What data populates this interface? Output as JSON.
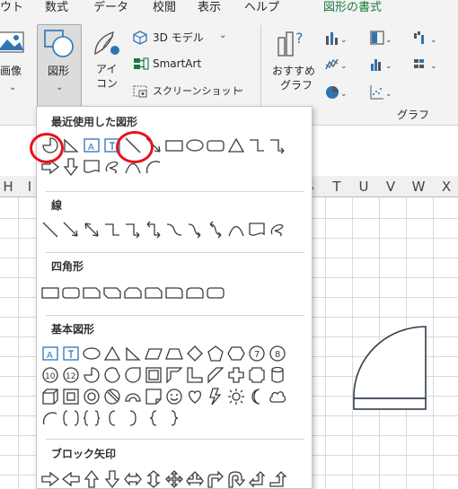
{
  "ribbon_tabs": [
    {
      "label": "ウト",
      "active": false
    },
    {
      "label": "数式",
      "active": false
    },
    {
      "label": "データ",
      "active": false
    },
    {
      "label": "校閲",
      "active": false
    },
    {
      "label": "表示",
      "active": false
    },
    {
      "label": "ヘルプ",
      "active": false
    },
    {
      "label": "図形の書式",
      "active": true
    }
  ],
  "ribbon": {
    "image_label": "画像",
    "shapes_label": "図形",
    "icons_label_1": "アイ",
    "icons_label_2": "コン",
    "model3d_label": "3D モデル",
    "smartart_label": "SmartArt",
    "screenshot_label": "スクリーンショット",
    "recommended_charts_1": "おすすめ",
    "recommended_charts_2": "グラフ",
    "group_charts_label": "グラフ"
  },
  "columns": [
    "H",
    "I",
    "S",
    "T",
    "U",
    "V",
    "W",
    "X"
  ],
  "shapes_menu": {
    "recent_title": "最近使用した図形",
    "lines_title": "線",
    "rectangles_title": "四角形",
    "basic_title": "基本図形",
    "block_arrows_title": "ブロック矢印"
  },
  "colors": {
    "accent_green": "#1a7a3a",
    "callout_red": "#e8121a",
    "icon_blue": "#2e74b5"
  }
}
